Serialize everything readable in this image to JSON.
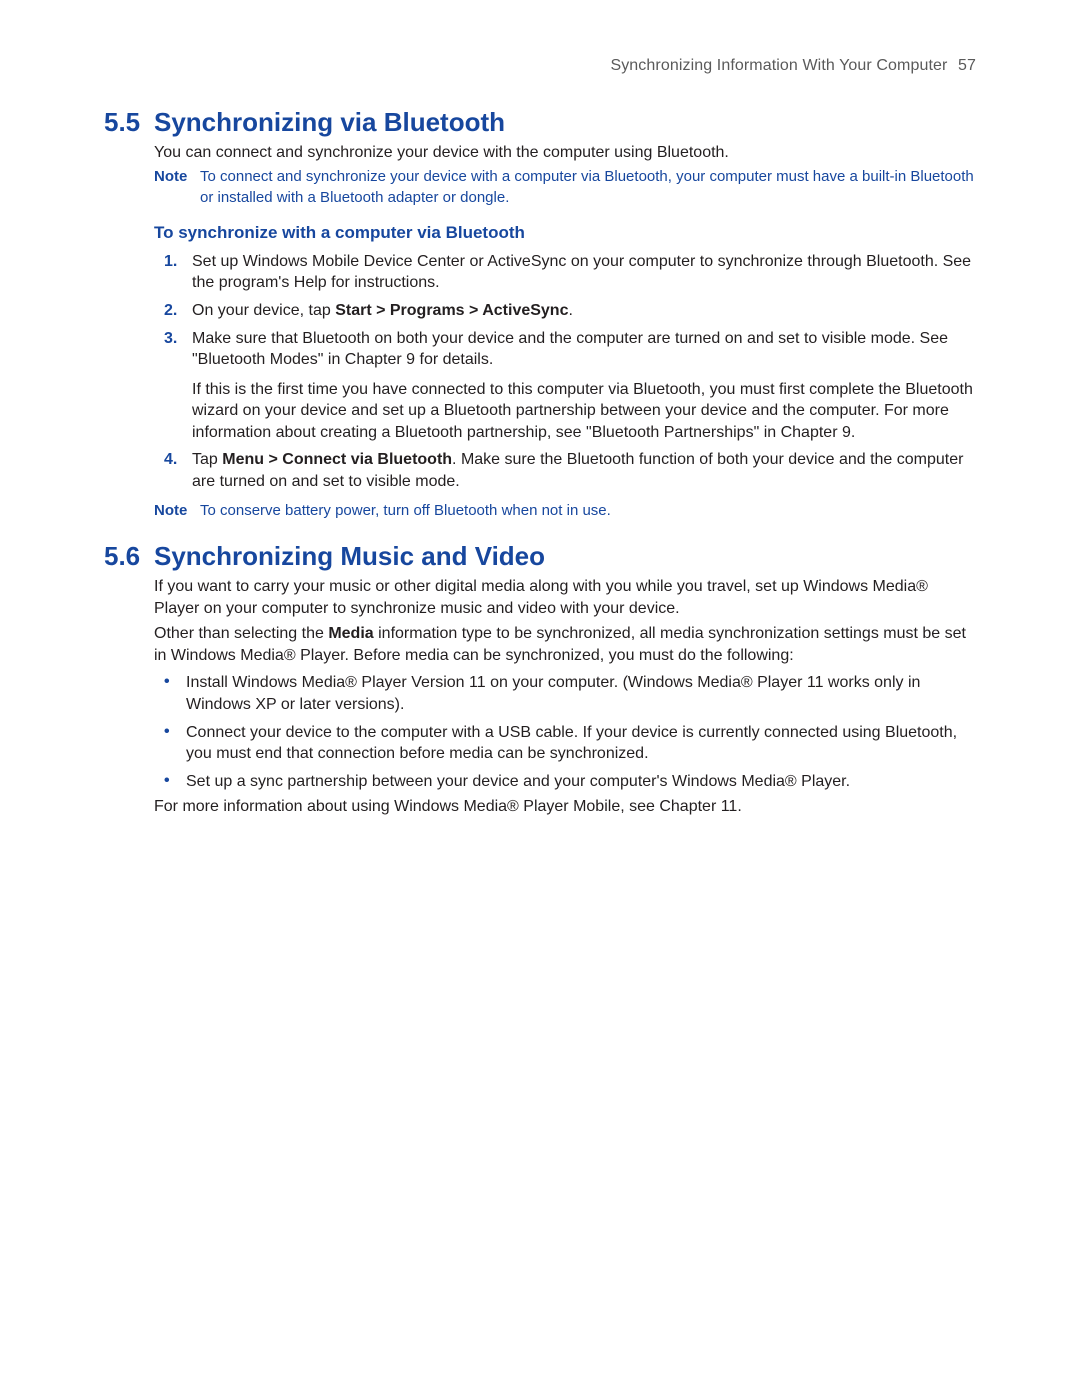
{
  "header": {
    "chapter_title": "Synchronizing Information With Your Computer",
    "page_number": "57"
  },
  "section55": {
    "number": "5.5",
    "title": "Synchronizing via Bluetooth",
    "intro": "You can connect and synchronize your device with the computer using Bluetooth.",
    "note1": {
      "label": "Note",
      "text": "To connect and synchronize your device with a computer via Bluetooth, your computer must have a built-in Bluetooth or installed with a Bluetooth adapter or dongle."
    },
    "subhead": "To synchronize with a computer via Bluetooth",
    "steps": {
      "s1": {
        "num": "1.",
        "text": "Set up Windows Mobile Device Center or ActiveSync on your computer to synchronize through Bluetooth. See the program's Help for instructions."
      },
      "s2": {
        "num": "2.",
        "pre": "On your device, tap ",
        "bold": "Start > Programs > ActiveSync",
        "post": "."
      },
      "s3": {
        "num": "3.",
        "text": "Make sure that Bluetooth on both your device and the computer are turned on and set to visible mode. See \"Bluetooth Modes\" in Chapter 9 for details.",
        "cont": "If this is the first time you have connected to this computer via Bluetooth, you must first complete the Bluetooth wizard on your device and set up a Bluetooth partnership between your device and the computer. For more information about creating a Bluetooth partnership, see \"Bluetooth Partnerships\" in Chapter 9."
      },
      "s4": {
        "num": "4.",
        "pre": "Tap ",
        "bold": "Menu > Connect via Bluetooth",
        "post": ". Make sure the Bluetooth function of both your device and the computer are turned on and set to visible mode."
      }
    },
    "note2": {
      "label": "Note",
      "text": "To conserve battery power, turn off Bluetooth when not in use."
    }
  },
  "section56": {
    "number": "5.6",
    "title": "Synchronizing Music and Video",
    "p1": "If you want to carry your music or other digital media along with you while you travel, set up Windows Media® Player on your computer to synchronize music and video with your device.",
    "p2_pre": "Other than selecting the ",
    "p2_bold": "Media",
    "p2_post": " information type to be synchronized, all media synchronization settings must be set in Windows Media® Player. Before media can be synchronized, you must do the following:",
    "bullets": {
      "b1": "Install Windows Media® Player Version 11 on your computer. (Windows Media® Player 11 works only in Windows XP or later versions).",
      "b2": "Connect your device to the computer with a USB cable. If your device is currently connected using Bluetooth, you must end that connection before media can be synchronized.",
      "b3": "Set up a sync partnership between your device and your computer's Windows Media® Player."
    },
    "p3": "For more information about using Windows Media® Player Mobile, see Chapter 11."
  }
}
